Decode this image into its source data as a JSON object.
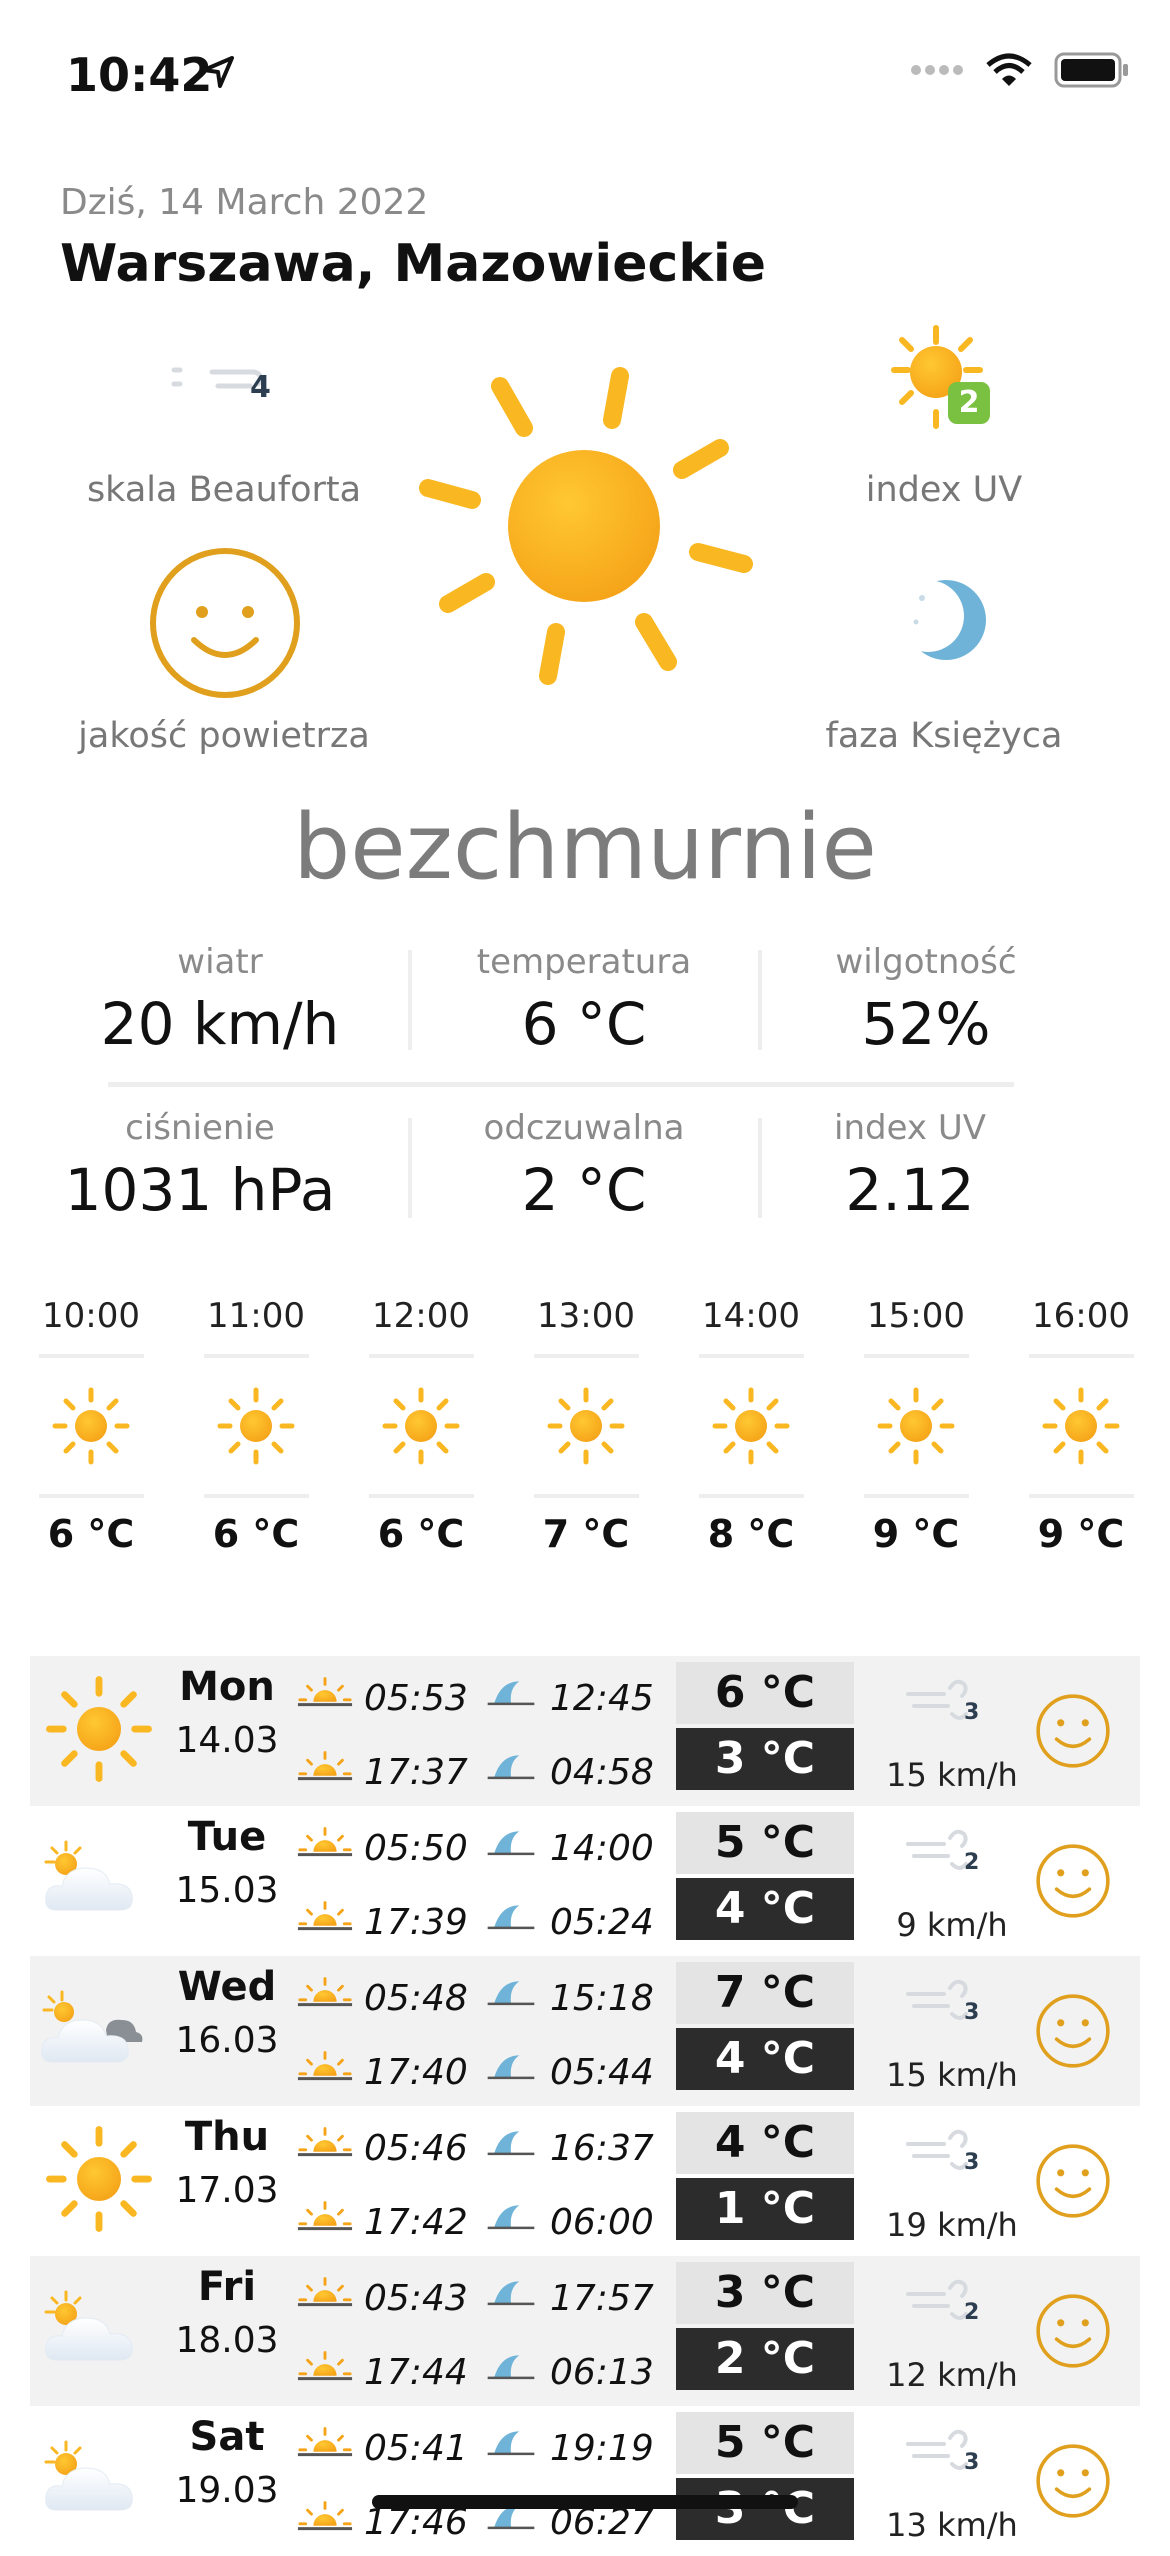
{
  "status_bar": {
    "time": "10:42"
  },
  "header": {
    "date": "Dziś, 14 March 2022",
    "location": "Warszawa, Mazowieckie"
  },
  "widgets": {
    "beaufort_label": "skala Beauforta",
    "beaufort_value": "4",
    "uv_label": "index UV",
    "uv_badge": "2",
    "air_label": "jakość powietrza",
    "moon_label": "faza Księżyca"
  },
  "condition": "bezchmurnie",
  "stats": [
    {
      "title": "wiatr",
      "value": "20 km/h"
    },
    {
      "title": "temperatura",
      "value": "6 °C"
    },
    {
      "title": "wilgotność",
      "value": "52%"
    },
    {
      "title": "ciśnienie",
      "value": "1031 hPa"
    },
    {
      "title": "odczuwalna",
      "value": "2 °C"
    },
    {
      "title": "index UV",
      "value": "2.12"
    }
  ],
  "hourly": [
    {
      "time": "10:00",
      "temp": "6 °C"
    },
    {
      "time": "11:00",
      "temp": "6 °C"
    },
    {
      "time": "12:00",
      "temp": "6 °C"
    },
    {
      "time": "13:00",
      "temp": "7 °C"
    },
    {
      "time": "14:00",
      "temp": "8 °C"
    },
    {
      "time": "15:00",
      "temp": "9 °C"
    },
    {
      "time": "16:00",
      "temp": "9 °C"
    }
  ],
  "daily": [
    {
      "day": "Mon",
      "date": "14.03",
      "icon": "sun-icon",
      "sunrise": "05:53",
      "sunset": "17:37",
      "moonrise": "12:45",
      "moonset": "04:58",
      "hi": "6 °C",
      "lo": "3 °C",
      "wind_beaufort": "3",
      "wind": "15 km/h"
    },
    {
      "day": "Tue",
      "date": "15.03",
      "icon": "partly-cloudy-icon",
      "sunrise": "05:50",
      "sunset": "17:39",
      "moonrise": "14:00",
      "moonset": "05:24",
      "hi": "5 °C",
      "lo": "4 °C",
      "wind_beaufort": "2",
      "wind": "9 km/h"
    },
    {
      "day": "Wed",
      "date": "16.03",
      "icon": "cloudy-icon",
      "sunrise": "05:48",
      "sunset": "17:40",
      "moonrise": "15:18",
      "moonset": "05:44",
      "hi": "7 °C",
      "lo": "4 °C",
      "wind_beaufort": "3",
      "wind": "15 km/h"
    },
    {
      "day": "Thu",
      "date": "17.03",
      "icon": "sun-icon",
      "sunrise": "05:46",
      "sunset": "17:42",
      "moonrise": "16:37",
      "moonset": "06:00",
      "hi": "4 °C",
      "lo": "1 °C",
      "wind_beaufort": "3",
      "wind": "19 km/h"
    },
    {
      "day": "Fri",
      "date": "18.03",
      "icon": "partly-cloudy-icon",
      "sunrise": "05:43",
      "sunset": "17:44",
      "moonrise": "17:57",
      "moonset": "06:13",
      "hi": "3 °C",
      "lo": "2 °C",
      "wind_beaufort": "2",
      "wind": "12 km/h"
    },
    {
      "day": "Sat",
      "date": "19.03",
      "icon": "partly-cloudy-icon",
      "sunrise": "05:41",
      "sunset": "17:46",
      "moonrise": "19:19",
      "moonset": "06:27",
      "hi": "5 °C",
      "lo": "3 °C",
      "wind_beaufort": "3",
      "wind": "13 km/h"
    }
  ],
  "colors": {
    "sun": "#f9b721",
    "uv_badge": "#7ac142",
    "air_face": "#e0a01e",
    "moon": "#6fb4d8",
    "dark_box": "#2c2c2c"
  }
}
